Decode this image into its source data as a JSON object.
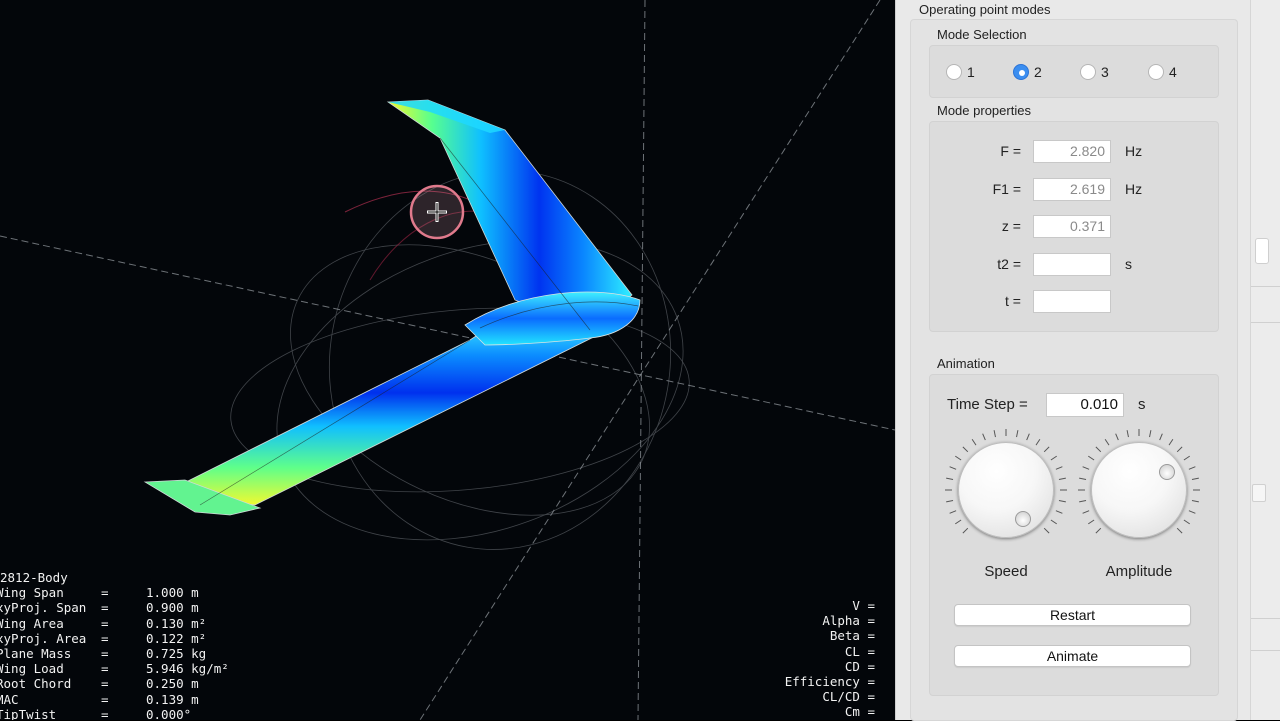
{
  "viewport": {
    "plane_name": "2812-Body",
    "properties": [
      {
        "name": "Wing Span",
        "eq": "=",
        "value": "1.000 m"
      },
      {
        "name": "xyProj. Span",
        "eq": "=",
        "value": "0.900 m"
      },
      {
        "name": "Wing Area",
        "eq": "=",
        "value": "0.130 m²"
      },
      {
        "name": "xyProj. Area",
        "eq": "=",
        "value": "0.122 m²"
      },
      {
        "name": "Plane Mass",
        "eq": "=",
        "value": "0.725 kg"
      },
      {
        "name": "Wing Load",
        "eq": "=",
        "value": "5.946 kg/m²"
      },
      {
        "name": "Root Chord",
        "eq": "=",
        "value": "0.250 m"
      },
      {
        "name": "MAC",
        "eq": "=",
        "value": "0.139 m"
      },
      {
        "name": "TipTwist",
        "eq": "=",
        "value": "0.000°"
      }
    ],
    "results": [
      "V =",
      "Alpha =",
      "Beta =",
      "CL =",
      "CD =",
      "Efficiency =",
      "CL/CD =",
      "Cm ="
    ]
  },
  "panel": {
    "title": "Operating point modes",
    "mode_selection": {
      "label": "Mode Selection",
      "options": [
        "1",
        "2",
        "3",
        "4"
      ],
      "selected": "2"
    },
    "mode_properties": {
      "label": "Mode properties",
      "F": {
        "label": "F =",
        "value": "2.820",
        "unit": "Hz"
      },
      "F1": {
        "label": "F1 =",
        "value": "2.619",
        "unit": "Hz"
      },
      "z": {
        "label": "z =",
        "value": "0.371"
      },
      "t2": {
        "label": "t2 =",
        "value": "",
        "unit": "s"
      },
      "t": {
        "label": "t =",
        "value": ""
      }
    },
    "animation": {
      "label": "Animation",
      "time_step": {
        "label": "Time Step =",
        "value": "0.010",
        "unit": "s"
      },
      "speed_label": "Speed",
      "amplitude_label": "Amplitude",
      "restart_label": "Restart",
      "animate_label": "Animate"
    }
  }
}
